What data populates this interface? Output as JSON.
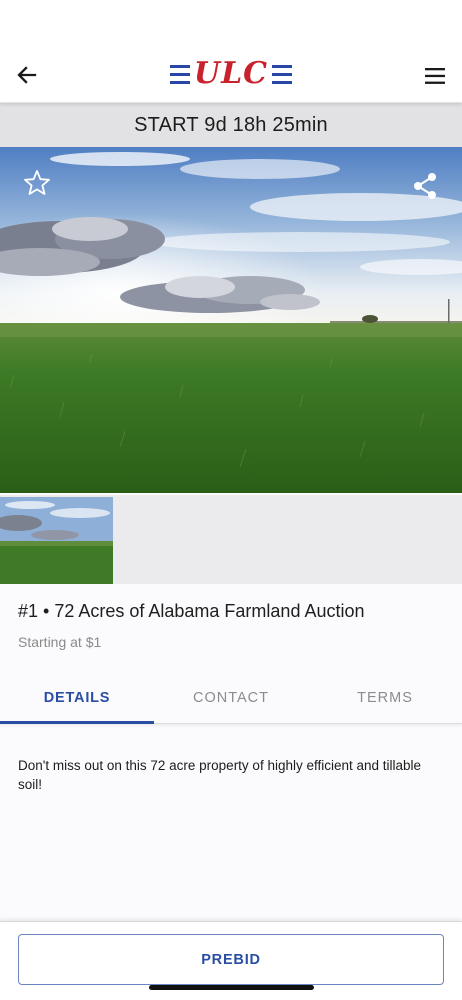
{
  "header": {
    "logo_text": "ULC",
    "back_icon": "arrow-left-icon",
    "menu_icon": "hamburger-menu-icon",
    "brand_colors": {
      "blue": "#2747a6",
      "red": "#c8232c"
    }
  },
  "countdown": {
    "text": "START 9d 18h 25min"
  },
  "hero": {
    "favorite_icon": "star-outline-icon",
    "share_icon": "share-icon"
  },
  "listing": {
    "title": "#1 • 72 Acres of Alabama Farmland Auction",
    "subtitle": "Starting at $1"
  },
  "tabs": [
    {
      "label": "DETAILS",
      "active": true
    },
    {
      "label": "CONTACT",
      "active": false
    },
    {
      "label": "TERMS",
      "active": false
    }
  ],
  "details": {
    "description": "Don't miss out on this 72 acre property of highly efficient and tillable soil!"
  },
  "footer": {
    "prebid_label": "PREBID"
  },
  "colors": {
    "accent": "#2a4ea3"
  }
}
